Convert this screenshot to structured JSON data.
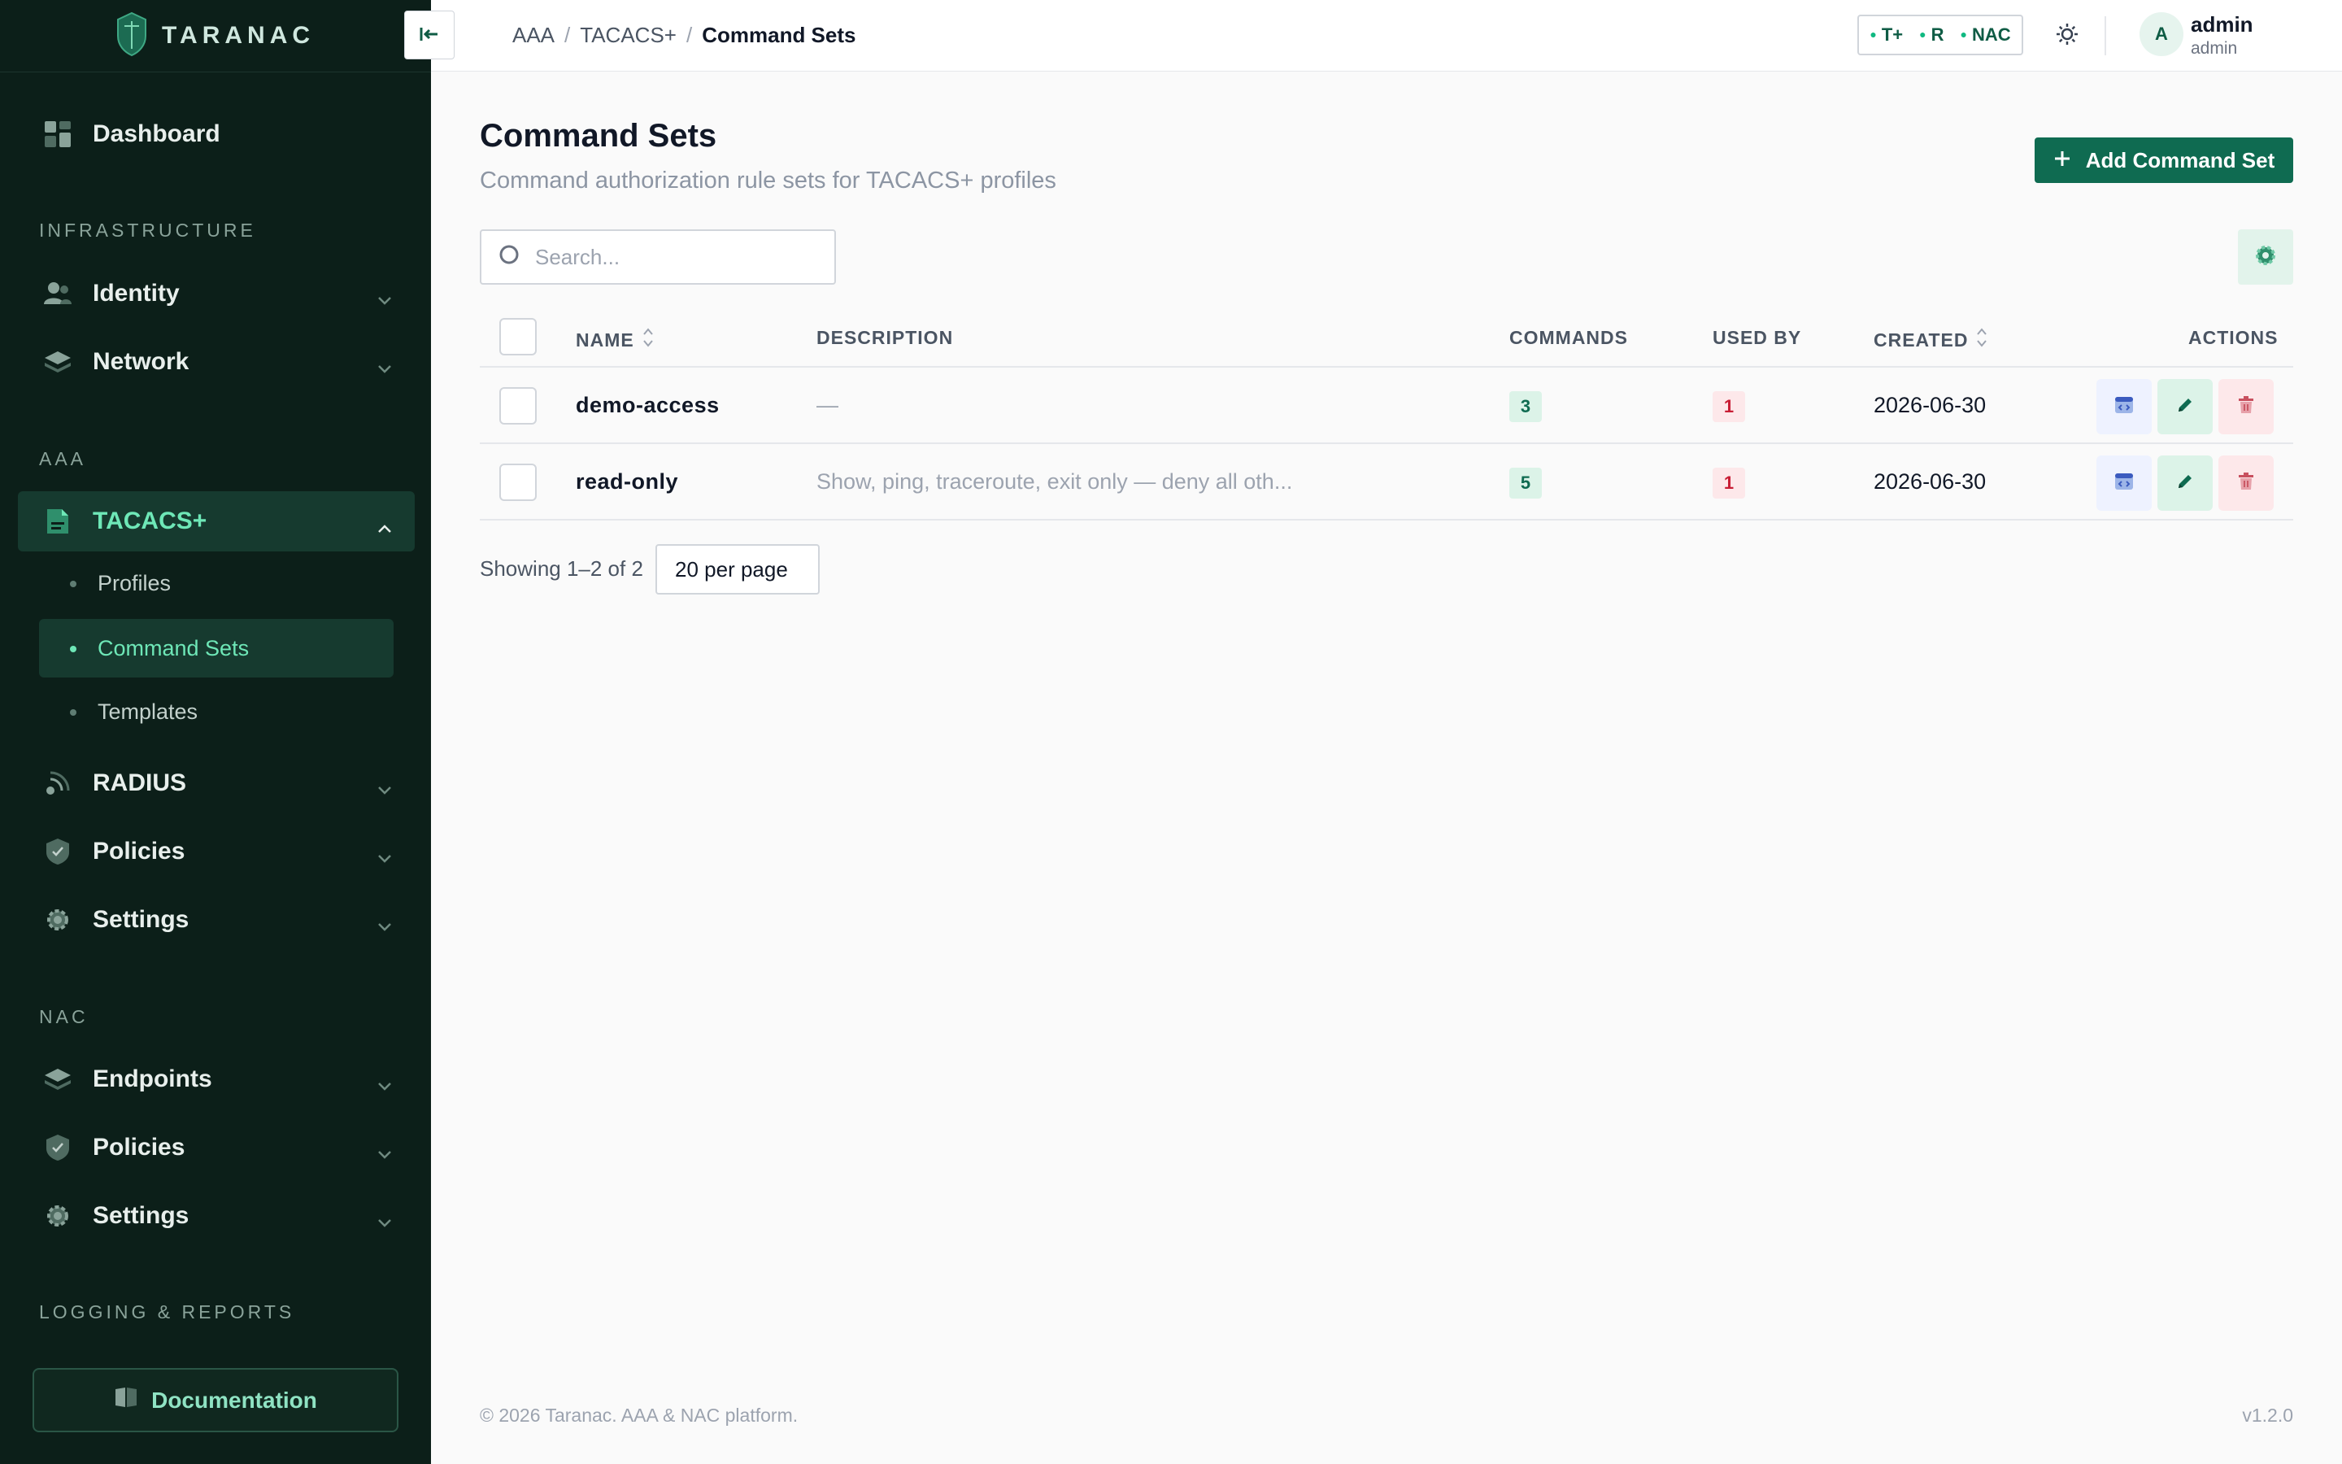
{
  "brand": {
    "name": "TARANAC"
  },
  "sidebar": {
    "dashboard": "Dashboard",
    "sections": {
      "infrastructure": "INFRASTRUCTURE",
      "aaa": "AAA",
      "nac": "NAC",
      "logging": "LOGGING & REPORTS"
    },
    "infra_items": {
      "identity": "Identity",
      "network": "Network"
    },
    "aaa_items": {
      "tacacs": "TACACS+",
      "tacacs_sub": {
        "profiles": "Profiles",
        "command_sets": "Command Sets",
        "templates": "Templates"
      },
      "radius": "RADIUS",
      "policies": "Policies",
      "settings": "Settings"
    },
    "nac_items": {
      "endpoints": "Endpoints",
      "policies": "Policies",
      "settings": "Settings"
    },
    "documentation": "Documentation"
  },
  "topbar": {
    "breadcrumb": [
      "AAA",
      "TACACS+",
      "Command Sets"
    ],
    "status": [
      "T+",
      "R",
      "NAC"
    ],
    "user": {
      "initial": "A",
      "name": "admin",
      "role": "admin"
    }
  },
  "page": {
    "title": "Command Sets",
    "subtitle": "Command authorization rule sets for TACACS+ profiles",
    "add_button": "Add Command Set",
    "search_placeholder": "Search..."
  },
  "table": {
    "columns": {
      "name": "NAME",
      "description": "DESCRIPTION",
      "commands": "COMMANDS",
      "used_by": "USED BY",
      "created": "CREATED",
      "actions": "ACTIONS"
    },
    "rows": [
      {
        "name": "demo-access",
        "description": "—",
        "commands": "3",
        "used_by": "1",
        "created": "2026-06-30"
      },
      {
        "name": "read-only",
        "description": "Show, ping, traceroute, exit only — deny all oth...",
        "commands": "5",
        "used_by": "1",
        "created": "2026-06-30"
      }
    ]
  },
  "pagination": {
    "showing": "Showing 1–2 of 2",
    "per_page": "20 per page"
  },
  "footer": {
    "copyright": "© 2026 Taranac. AAA & NAC platform.",
    "version": "v1.2.0"
  },
  "colors": {
    "sidebar_bg": "#0c1f19",
    "accent": "#0f6b51",
    "active_text": "#6ee7b7",
    "danger": "#c81e35"
  }
}
